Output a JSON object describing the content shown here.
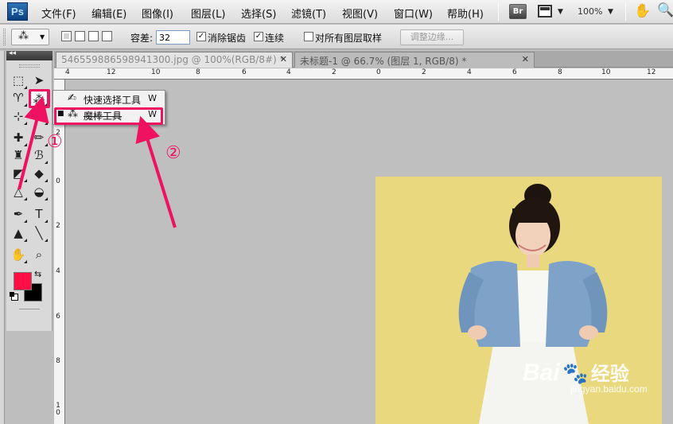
{
  "app": {
    "logo": "Ps"
  },
  "menubar": {
    "items": [
      "文件(F)",
      "编辑(E)",
      "图像(I)",
      "图层(L)",
      "选择(S)",
      "滤镜(T)",
      "视图(V)",
      "窗口(W)",
      "帮助(H)"
    ],
    "bridge_label": "Br",
    "zoom": "100%"
  },
  "options": {
    "tolerance_label": "容差:",
    "tolerance_value": "32",
    "anti_alias_label": "消除锯齿",
    "anti_alias_checked": true,
    "contiguous_label": "连续",
    "contiguous_checked": true,
    "sample_all_label": "对所有图层取样",
    "sample_all_checked": false,
    "refine_edge_label": "调整边缘..."
  },
  "tabs": [
    {
      "title": "546559886598941300.jpg @ 100%(RGB/8#) *",
      "active": true
    },
    {
      "title": "未标题-1 @ 66.7% (图层 1, RGB/8) *",
      "active": false
    }
  ],
  "flyout": {
    "items": [
      {
        "icon": "quick-selection-icon",
        "label": "快速选择工具",
        "shortcut": "W",
        "selected": false
      },
      {
        "icon": "magic-wand-icon",
        "label": "魔棒工具",
        "shortcut": "W",
        "selected": true
      }
    ]
  },
  "colors": {
    "foreground": "#ff0f43",
    "background": "#000000",
    "annotation": "#ef1261",
    "photo_bg": "#ead87e"
  },
  "annotations": {
    "step1": "①",
    "step2": "②"
  },
  "ruler_top": [
    "4",
    "12",
    "10",
    "8",
    "6",
    "4",
    "2",
    "0",
    "2",
    "4",
    "6",
    "8",
    "10",
    "12"
  ],
  "ruler_left": [
    "2",
    "0",
    "2",
    "4",
    "6",
    "8",
    "1 0"
  ],
  "watermark": {
    "brand": "Bai",
    "brand2": "经验",
    "url": "jingyan.baidu.com"
  }
}
